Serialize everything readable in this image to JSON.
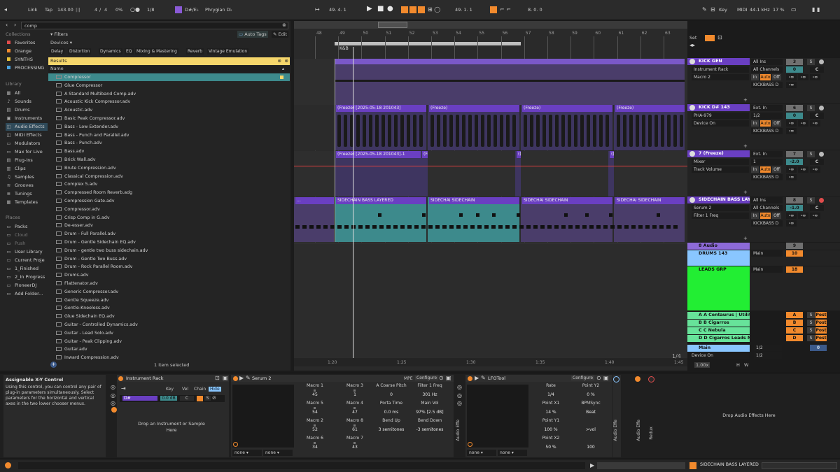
{
  "colors": {
    "purple": "#6a3fc2",
    "orange": "#f28a2d",
    "teal": "#3d8a8c",
    "green": "#22ee33",
    "lightblue": "#89c6ff",
    "yellow": "#f5d66b"
  },
  "transport": {
    "link": "Link",
    "tap": "Tap",
    "tempo": "143.00",
    "sig_num": "4",
    "sig_sep": "/",
    "sig_den": "4",
    "cpu": "0%",
    "quant": "1/8",
    "key_root": "D#/E♭",
    "scale": "Phrygian D♭",
    "position": "49.  4.  1",
    "loop_start": "49.  1.  1",
    "loop_len": "8.  0.  0",
    "key_label": "Key",
    "midi_label": "MIDI",
    "sample_rate": "44.1 kHz",
    "cpu_pct": "17 %",
    "bars_sep": "|||"
  },
  "browser": {
    "search": "comp",
    "filters": "Filters",
    "auto_tags": "Auto Tags",
    "edit": "Edit",
    "devices_label": "Devices",
    "chips": [
      "Delay",
      "Distortion",
      "Dynamics",
      "EQ",
      "Mixing & Mastering",
      "Reverb",
      "Vintage Emulation"
    ],
    "results_label": "Results",
    "name_header": "Name",
    "selected_count": "1 item selected",
    "collections_label": "Collections",
    "collections": [
      {
        "name": "Favorites",
        "color": "#e14c4c"
      },
      {
        "name": "Orange",
        "color": "#f28a2d"
      },
      {
        "name": "SYNTHS",
        "color": "#e7c23b"
      },
      {
        "name": "PROCESSING",
        "color": "#4aa3df"
      }
    ],
    "library_label": "Library",
    "library": [
      "All",
      "Sounds",
      "Drums",
      "Instruments",
      "Audio Effects",
      "MIDI Effects",
      "Modulators",
      "Max for Live",
      "Plug-Ins",
      "Clips",
      "Samples",
      "Grooves",
      "Tunings",
      "Templates"
    ],
    "places_label": "Places",
    "places": [
      "Packs",
      "Cloud",
      "Push",
      "User Library",
      "Current Proje",
      "1_Finished",
      "2_In Progress",
      "PioneerDJ",
      "Add Folder..."
    ],
    "results": [
      "Compressor",
      "Glue Compressor",
      "A Standard Multiband Comp.adv",
      "Acoustic Kick Compressor.adv",
      "Acoustic.adv",
      "Basic Peak Compressor.adv",
      "Bass - Low Extender.adv",
      "Bass - Punch and Parallel.adv",
      "Bass - Punch.adv",
      "Bass.adv",
      "Brick Wall.adv",
      "Brute Compression.adv",
      "Classical Compression.adv",
      "Complex 5.adv",
      "Compressed Room Reverb.adg",
      "Compression Gate.adv",
      "Compressor.adv",
      "Crisp Comp in G.adv",
      "De-esser.adv",
      "Drum - Full Parallel.adv",
      "Drum - Gentle Sidechain EQ.adv",
      "Drum - gentle two buss sidechain.adv",
      "Drum - Gentle Two Buss.adv",
      "Drum - Rock Parallel Room.adv",
      "Drums.adv",
      "Flattenator.adv",
      "Generic Compressor.adv",
      "Gentle Squeeze.adv",
      "Gentle-Kneeless.adv",
      "Glue Sidechain EQ.adv",
      "Guitar - Controlled Dynamics.adv",
      "Guitar - Lead Solo.adv",
      "Guitar - Peak Clipping.adv",
      "Guitar.adv",
      "Inward Compression.adv"
    ]
  },
  "arrangement": {
    "ruler": [
      "48",
      "49",
      "50",
      "51",
      "52",
      "53",
      "54",
      "55",
      "56",
      "57",
      "58",
      "59",
      "60",
      "61",
      "62",
      "63"
    ],
    "loop_label": "K&B",
    "time_ruler": [
      "1:20",
      "1:25",
      "1:30",
      "1:35",
      "1:40",
      "1:45"
    ],
    "zoom": "1/4",
    "clips": {
      "freeze1": "(Freeze) [2025-05-18 201043]",
      "freeze": "(Freeze)",
      "freeze2": "(Freeze) [2025-05-18 201043]-1",
      "freeze_short": "(Fr",
      "paren": "((",
      "bass1": "SIDECHAIN BASS LAYERED",
      "bass2": "SIDECHAI",
      "bass3": "SIDECHAIN",
      "bass4": "SI",
      "bass5": "SIDECHAI SIDECHAIN",
      "ellipsis": "..."
    }
  },
  "mixer": {
    "set": "Set",
    "tracks": [
      {
        "name": "KICK GEN",
        "color": "#6a3fc2",
        "dev1": "Instrument Rack",
        "dev2": "Macro 2",
        "in": "All Ins",
        "ch": "All Channels",
        "mon_in": "In",
        "mon_auto": "Auto",
        "mon_off": "Off",
        "out": "KICKBASS D",
        "num": "3",
        "vol": "0",
        "pan": "C",
        "inf": "-∞"
      },
      {
        "name": "KICK D# 143",
        "color": "#6a3fc2",
        "dev1": "PHA-979",
        "dev2": "Device On",
        "in": "Ext. In",
        "ch": "1/2",
        "mon_in": "In",
        "mon_auto": "Auto",
        "mon_off": "Off",
        "out": "KICKBASS D",
        "num": "6",
        "vol": "0",
        "pan": "C",
        "inf": "-∞"
      },
      {
        "name": "7 (Freeze)",
        "color": "#6a3fc2",
        "dev1": "Mixer",
        "dev2": "Track Volume",
        "in": "Ext. In",
        "ch": "1",
        "mon_in": "In",
        "mon_auto": "Auto",
        "mon_off": "Off",
        "out": "KICKBASS D",
        "num": "7",
        "vol": "-2.0",
        "pan": "C",
        "inf": "-∞"
      },
      {
        "name": "SIDECHAIN BASS LAYER",
        "color": "#6a3fc2",
        "dev1": "Serum 2",
        "dev2": "Filter 1 Freq",
        "in": "All Ins",
        "ch": "All Channels",
        "mon_in": "In",
        "mon_auto": "Auto",
        "mon_off": "Off",
        "out": "KICKBASS D",
        "num": "8",
        "vol": "-1.0",
        "pan": "C",
        "inf": "-∞"
      }
    ],
    "audio8": "8 Audio",
    "audio8_num": "9",
    "drums": "DRUMS 143",
    "drums_out": "Main",
    "drums_num": "10",
    "leads": "LEADS GRP",
    "leads_out": "Main",
    "leads_num": "18",
    "returns": [
      {
        "name": "A A Centaurus | Utility",
        "letter": "A",
        "color": "#67e39a"
      },
      {
        "name": "B B Cigarros",
        "letter": "B",
        "color": "#67e39a"
      },
      {
        "name": "C C Nebula",
        "letter": "C",
        "color": "#67e39a"
      },
      {
        "name": "D D Cigarros Leads Mast",
        "letter": "D",
        "color": "#67e39a"
      }
    ],
    "post": "Post",
    "main": "Main",
    "main_ratio": "1/2",
    "main_dev": "Device On",
    "main_vol": "0",
    "main_ratio2": "1/2",
    "zero": "0",
    "zero2": "0",
    "zoom_val": "1.00x",
    "h": "H",
    "w": "W"
  },
  "devices": {
    "xy_title": "Assignable X-Y Control",
    "xy_text": "Using this control, you can control any pair of plug-in parameters simultaneously. Select parameters for the horizontal and vertical axes in the two lower chooser menus.",
    "rack_title": "Instrument Rack",
    "rack_key": "Key",
    "rack_vel": "Vel",
    "rack_chain": "Chain",
    "rack_hide": "Hide",
    "chain_name": "D#",
    "chain_vol": "0.0 dB",
    "chain_pan": "C",
    "chain_s": "S",
    "drop_inst": "Drop an Instrument or Sample Here",
    "serum_title": "Serum 2",
    "serum_mpe": "MPE",
    "serum_config": "Configure",
    "none1": "none",
    "none2": "none",
    "macros": [
      {
        "name": "Macro 1",
        "val": "45"
      },
      {
        "name": "Macro 3",
        "val": "1"
      },
      {
        "name": "Macro 5",
        "val": "54"
      },
      {
        "name": "Macro 4",
        "val": "47"
      },
      {
        "name": "Macro 2",
        "val": "52"
      },
      {
        "name": "Macro 8",
        "val": "61"
      },
      {
        "name": "Macro 6",
        "val": "34"
      },
      {
        "name": "Macro 7",
        "val": "43"
      }
    ],
    "serum_params": [
      {
        "name": "A Coarse Pitch",
        "val": "0"
      },
      {
        "name": "Filter 1 Freq",
        "val": "301 Hz"
      },
      {
        "name": "Porta Time",
        "val": "0.0 ms"
      },
      {
        "name": "Main Vol",
        "val": "97% [2.5 dB]"
      },
      {
        "name": "Bend Up",
        "val": "3 semitones"
      },
      {
        "name": "Bend Down",
        "val": "-3 semitones"
      }
    ],
    "lfo_title": "LFOTool",
    "lfo_config": "Configure",
    "lfo_none1": "none",
    "lfo_none2": "none",
    "lfo_params": [
      {
        "name": "Rate",
        "val": "1/4"
      },
      {
        "name": "Point Y2",
        "val": "0 %"
      },
      {
        "name": "Point X1",
        "val": "14 %"
      },
      {
        "name": "BPMSync",
        "val": "Beat"
      },
      {
        "name": "Point Y1",
        "val": "100 %"
      },
      {
        "name": "",
        "val": ">vol"
      },
      {
        "name": "Point X2",
        "val": "50 %"
      },
      {
        "name": "",
        "val": "100"
      }
    ],
    "audio_fx1": "Audio Effe",
    "audio_fx2": "Audio Effe",
    "audio_fx3": "Audio Effe",
    "redux": "Redux",
    "drop_fx": "Drop Audio Effects Here"
  },
  "status": {
    "track": "SIDECHAIN BASS LAYERED"
  }
}
